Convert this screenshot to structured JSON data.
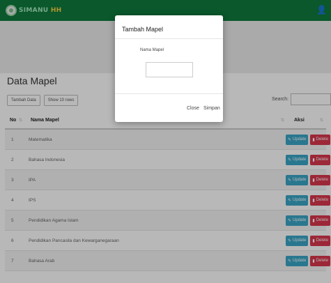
{
  "navbar": {
    "brand_part1": "SIMANU",
    "brand_part2": "HH",
    "user_icon": "user-icon"
  },
  "page": {
    "title": "Data Mapel"
  },
  "toolbar": {
    "add_label": "Tambah Data",
    "show_label": "Show 10 rows",
    "search_label": "Search:",
    "search_value": ""
  },
  "table": {
    "headers": {
      "no": "No",
      "nama": "Nama Mapel",
      "aksi": "Aksi"
    },
    "update_label": "Update",
    "delete_label": "Delete",
    "rows": [
      {
        "no": "1",
        "nama": "Matematika"
      },
      {
        "no": "2",
        "nama": "Bahasa Indonesia"
      },
      {
        "no": "3",
        "nama": "IPA"
      },
      {
        "no": "4",
        "nama": "IPS"
      },
      {
        "no": "5",
        "nama": "Pendidikan Agama Islam"
      },
      {
        "no": "6",
        "nama": "Pendidikan Pancasila dan Kewarganegaraan"
      },
      {
        "no": "7",
        "nama": "Bahasa Arab"
      }
    ]
  },
  "modal": {
    "title": "Tambah Mapel",
    "field_label": "Nama Mapel",
    "field_value": "",
    "close_label": "Close",
    "save_label": "Simpan"
  },
  "colors": {
    "navbar": "#0e7a3d",
    "update": "#3aa6c6",
    "delete": "#d9374d",
    "brand_yellow": "#f4d03f"
  }
}
